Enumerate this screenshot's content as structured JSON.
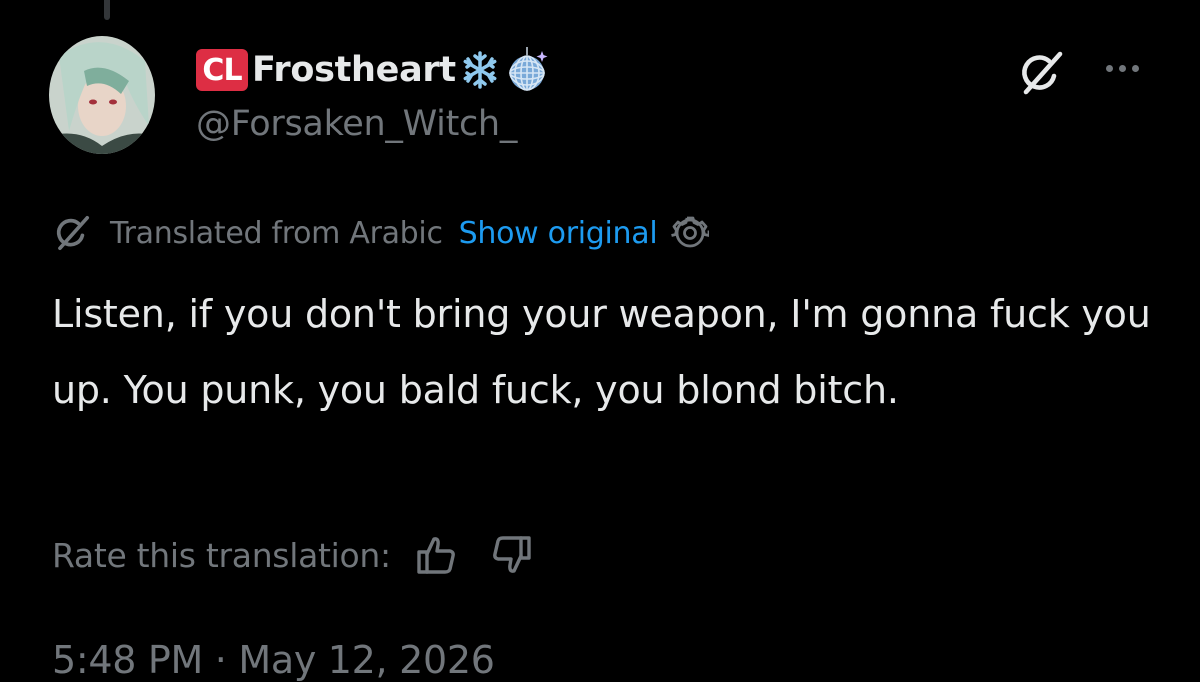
{
  "author": {
    "badge": "CL",
    "display_name": "Frostheart",
    "name_emojis": [
      "snowflake-emoji",
      "disco-ball-emoji"
    ],
    "handle": "@Forsaken_Witch_"
  },
  "header": {
    "grok_icon": "grok-icon",
    "more_icon": "more-horizontal-icon"
  },
  "translation": {
    "label": "Translated from Arabic",
    "show_original": "Show original",
    "settings_icon": "gear-icon"
  },
  "tweet": {
    "text": "Listen, if you don't bring your weapon, I'm gonna fuck you up. You punk, you bald fuck, you blond bitch."
  },
  "rating": {
    "label": "Rate this translation:",
    "up_icon": "thumbs-up-icon",
    "down_icon": "thumbs-down-icon"
  },
  "meta": {
    "timestamp": "5:48 PM · May 12, 2026"
  },
  "colors": {
    "background": "#000000",
    "text": "#e7e9ea",
    "secondary": "#71767b",
    "link": "#1d9bf0",
    "badge": "#dd2e44"
  }
}
